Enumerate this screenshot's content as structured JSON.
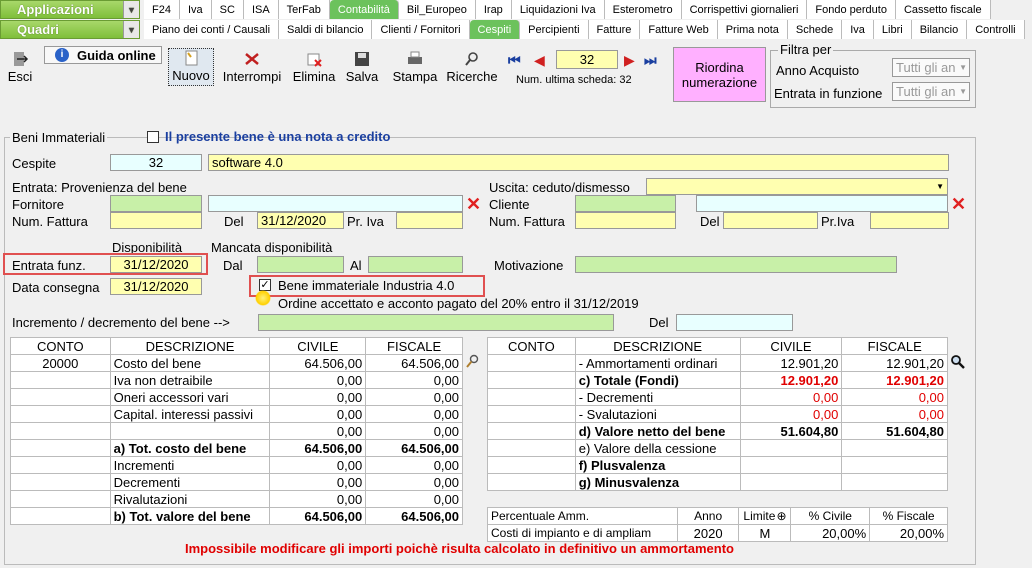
{
  "nav": {
    "applicazioni": "Applicazioni",
    "quadri": "Quadri",
    "row1": [
      "F24",
      "Iva",
      "SC",
      "ISA",
      "TerFab",
      "Contabilità",
      "Bil_Europeo",
      "Irap",
      "Liquidazioni Iva",
      "Esterometro",
      "Corrispettivi giornalieri",
      "Fondo perduto",
      "Cassetto fiscale"
    ],
    "row2": [
      "Piano dei conti / Causali",
      "Saldi di bilancio",
      "Clienti / Fornitori",
      "Cespiti",
      "Percipienti",
      "Fatture",
      "Fatture Web",
      "Prima nota",
      "Schede",
      "Iva",
      "Libri",
      "Bilancio",
      "Controlli"
    ]
  },
  "toolbar": {
    "esci": "Esci",
    "guida": "Guida online",
    "nuovo": "Nuovo",
    "interrompi": "Interrompi",
    "elimina": "Elimina",
    "salva": "Salva",
    "stampa": "Stampa",
    "ricerche": "Ricerche",
    "scheda": "32",
    "ultima_label": "Num. ultima scheda:",
    "ultima_val": "32",
    "riordina": "Riordina numerazione"
  },
  "filtro": {
    "title": "Filtra per",
    "anno_label": "Anno Acquisto",
    "anno_val": "Tutti gli an",
    "entrata_label": "Entrata in funzione",
    "entrata_val": "Tutti gli an"
  },
  "form": {
    "beni": "Beni Immateriali",
    "nota_credito": "Il presente bene è una nota a credito",
    "cespite_label": "Cespite",
    "cespite_num": "32",
    "cespite_desc": "software 4.0",
    "entrata_title": "Entrata: Provenienza del bene",
    "fornitore": "Fornitore",
    "num_fattura": "Num. Fattura",
    "del": "Del",
    "data_fatt": "31/12/2020",
    "pr_iva": "Pr. Iva",
    "uscita_title": "Uscita: ceduto/dismesso",
    "cliente": "Cliente",
    "num_fattura2": "Num. Fattura",
    "del2": "Del",
    "pr_iva2": "Pr.Iva",
    "disponibilita": "Disponibilità",
    "mancata": "Mancata disponibilità",
    "entrata_funz": "Entrata funz.",
    "entrata_funz_val": "31/12/2020",
    "dal": "Dal",
    "al": "Al",
    "motivazione": "Motivazione",
    "data_consegna": "Data consegna",
    "data_consegna_val": "31/12/2020",
    "industria": "Bene immateriale Industria 4.0",
    "ordine": "Ordine accettato e acconto pagato del 20% entro il 31/12/2019",
    "incremento": "Incremento / decremento del bene -->",
    "del3": "Del"
  },
  "left_table": {
    "headers": [
      "CONTO",
      "DESCRIZIONE",
      "CIVILE",
      "FISCALE"
    ],
    "rows": [
      [
        "20000",
        "Costo del bene",
        "64.506,00",
        "64.506,00"
      ],
      [
        "",
        "Iva non detraibile",
        "0,00",
        "0,00"
      ],
      [
        "",
        "Oneri accessori vari",
        "0,00",
        "0,00"
      ],
      [
        "",
        "Capital. interessi passivi",
        "0,00",
        "0,00"
      ],
      [
        "",
        "",
        "0,00",
        "0,00"
      ],
      [
        "",
        "a) Tot. costo del bene",
        "64.506,00",
        "64.506,00"
      ],
      [
        "",
        "Incrementi",
        "0,00",
        "0,00"
      ],
      [
        "",
        "Decrementi",
        "0,00",
        "0,00"
      ],
      [
        "",
        "Rivalutazioni",
        "0,00",
        "0,00"
      ],
      [
        "",
        "b) Tot. valore del bene",
        "64.506,00",
        "64.506,00"
      ]
    ]
  },
  "right_table": {
    "headers": [
      "CONTO",
      "DESCRIZIONE",
      "CIVILE",
      "FISCALE"
    ],
    "rows": [
      [
        "",
        "- Ammortamenti ordinari",
        "12.901,20",
        "12.901,20"
      ],
      [
        "",
        "c) Totale (Fondi)",
        "12.901,20",
        "12.901,20"
      ],
      [
        "",
        "- Decrementi",
        "0,00",
        "0,00"
      ],
      [
        "",
        "- Svalutazioni",
        "0,00",
        "0,00"
      ],
      [
        "",
        "d) Valore netto del bene",
        "51.604,80",
        "51.604,80"
      ],
      [
        "",
        "e) Valore della cessione",
        "",
        ""
      ],
      [
        "",
        "f) Plusvalenza",
        "",
        ""
      ],
      [
        "",
        "g) Minusvalenza",
        "",
        ""
      ]
    ]
  },
  "perc_table": {
    "headers": [
      "Percentuale Amm.",
      "Anno",
      "Limite",
      "% Civile",
      "% Fiscale"
    ],
    "row": [
      "Costi di impianto e di ampliam",
      "2020",
      "M",
      "20,00%",
      "20,00%"
    ]
  },
  "warning": "Impossibile modificare gli importi poichè risulta calcolato in definitivo un ammortamento"
}
